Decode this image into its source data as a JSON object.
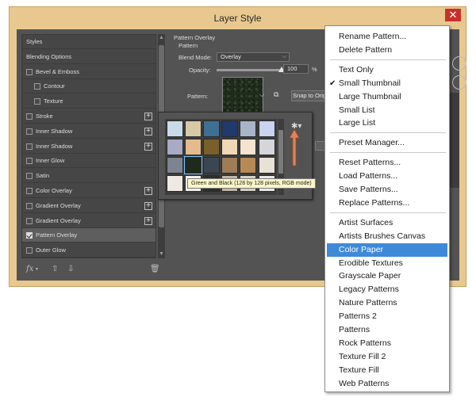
{
  "window": {
    "title": "Layer Style",
    "close_glyph": "✕"
  },
  "styles_list": {
    "header": "Styles",
    "items": [
      {
        "label": "Blending Options",
        "checkbox": false,
        "checked": false,
        "indent": 0,
        "plus": false
      },
      {
        "label": "Bevel & Emboss",
        "checkbox": true,
        "checked": false,
        "indent": 0,
        "plus": false
      },
      {
        "label": "Contour",
        "checkbox": true,
        "checked": false,
        "indent": 1,
        "plus": false
      },
      {
        "label": "Texture",
        "checkbox": true,
        "checked": false,
        "indent": 1,
        "plus": false
      },
      {
        "label": "Stroke",
        "checkbox": true,
        "checked": false,
        "indent": 0,
        "plus": true
      },
      {
        "label": "Inner Shadow",
        "checkbox": true,
        "checked": false,
        "indent": 0,
        "plus": true
      },
      {
        "label": "Inner Shadow",
        "checkbox": true,
        "checked": false,
        "indent": 0,
        "plus": true
      },
      {
        "label": "Inner Glow",
        "checkbox": true,
        "checked": false,
        "indent": 0,
        "plus": false
      },
      {
        "label": "Satin",
        "checkbox": true,
        "checked": false,
        "indent": 0,
        "plus": false
      },
      {
        "label": "Color Overlay",
        "checkbox": true,
        "checked": false,
        "indent": 0,
        "plus": true
      },
      {
        "label": "Gradient Overlay",
        "checkbox": true,
        "checked": false,
        "indent": 0,
        "plus": true
      },
      {
        "label": "Gradient Overlay",
        "checkbox": true,
        "checked": false,
        "indent": 0,
        "plus": true
      },
      {
        "label": "Pattern Overlay",
        "checkbox": true,
        "checked": true,
        "indent": 0,
        "plus": false,
        "selected": true
      },
      {
        "label": "Outer Glow",
        "checkbox": true,
        "checked": false,
        "indent": 0,
        "plus": false
      }
    ],
    "bottom_icons": [
      "fx-icon",
      "arrow-up-icon",
      "arrow-down-icon",
      "trash-icon"
    ],
    "fx_label": "fx"
  },
  "pattern_overlay": {
    "group_title": "Pattern Overlay",
    "sub_title": "Pattern",
    "blend_mode_label": "Blend Mode:",
    "blend_mode_value": "Overlay",
    "opacity_label": "Opacity:",
    "opacity_value": "100",
    "opacity_unit": "%",
    "opacity_level": 1.0,
    "pattern_label": "Pattern:",
    "snap_button": "Snap to Origin"
  },
  "pattern_picker": {
    "tooltip": "Green and Black (128 by 128 pixels, RGB mode)",
    "tiles": [
      "#c9dbe8",
      "#d8c8a6",
      "#3f6f93",
      "#1f3a6b",
      "#a8b4c8",
      "#c8d4f0",
      "#a9aac6",
      "#e5bb8d",
      "#7a5f2a",
      "#f0d7b5",
      "#f3e3cf",
      "#d4d6da",
      "#7e8390",
      "#1e2a1c",
      "#3a4750",
      "#9e7c58",
      "#b58a55",
      "#e8e2d6",
      "#efe9e2",
      "#f2efea",
      "#2a2f2a",
      "#c2b6a4",
      "#d8d0c4",
      "#e8e8e8"
    ],
    "selected_index": 13
  },
  "menu": {
    "groups": [
      [
        "Rename Pattern...",
        "Delete Pattern"
      ],
      [
        "Text Only",
        "Small Thumbnail",
        "Large Thumbnail",
        "Small List",
        "Large List"
      ],
      [
        "Preset Manager..."
      ],
      [
        "Reset Patterns...",
        "Load Patterns...",
        "Save Patterns...",
        "Replace Patterns..."
      ],
      [
        "Artist Surfaces",
        "Artists Brushes Canvas",
        "Color Paper",
        "Erodible Textures",
        "Grayscale Paper",
        "Legacy Patterns",
        "Nature Patterns",
        "Patterns 2",
        "Patterns",
        "Rock Patterns",
        "Texture Fill 2",
        "Texture Fill",
        "Web Patterns"
      ]
    ],
    "checked_item": "Small Thumbnail",
    "highlighted_item": "Color Paper",
    "check_glyph": "✔"
  },
  "colors": {
    "frame": "#e9c88f",
    "panel": "#535353",
    "highlight": "#3f8ad8",
    "arrow": "#e0835a"
  }
}
